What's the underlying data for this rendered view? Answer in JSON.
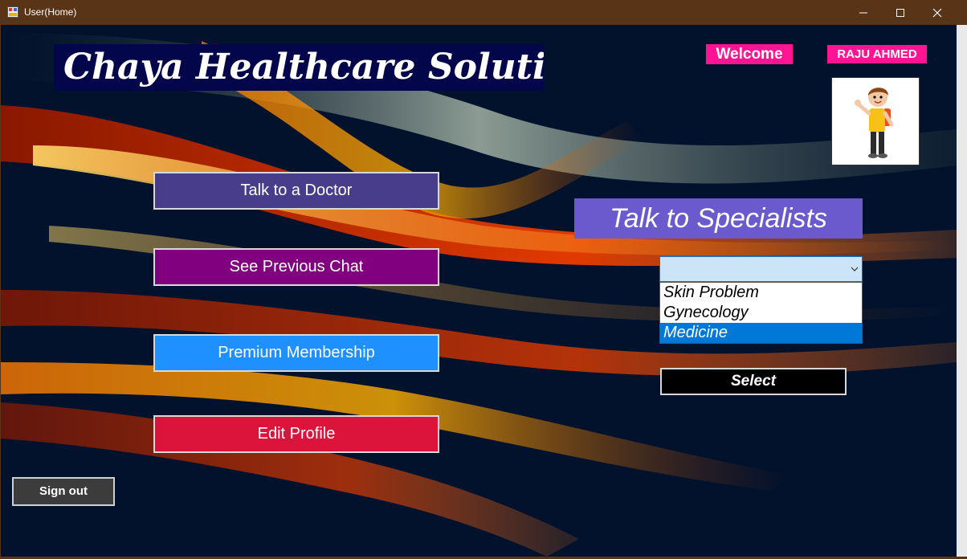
{
  "window": {
    "title": "User(Home)"
  },
  "header": {
    "brand": "Chaya Healthcare Solution",
    "welcome_label": "Welcome",
    "user_name": "RAJU AHMED"
  },
  "menu": {
    "talk_to_doctor": "Talk to a Doctor",
    "previous_chat": "See Previous Chat",
    "premium": "Premium Membership",
    "edit_profile": "Edit Profile"
  },
  "specialists": {
    "title": "Talk to Specialists",
    "combo_value": "",
    "options": [
      "Skin Problem",
      "Gynecology",
      "Medicine"
    ],
    "selected_option": "Medicine",
    "select_label": "Select"
  },
  "footer": {
    "sign_out": "Sign out"
  },
  "colors": {
    "titlebar": "#5a3417",
    "talk_btn": "#483d8b",
    "chat_btn": "#800080",
    "premium_btn": "#1e90ff",
    "edit_btn": "#dc143c",
    "spec_header": "#6a5acd",
    "pink_badge": "#ff1493",
    "highlight": "#0078d7"
  }
}
